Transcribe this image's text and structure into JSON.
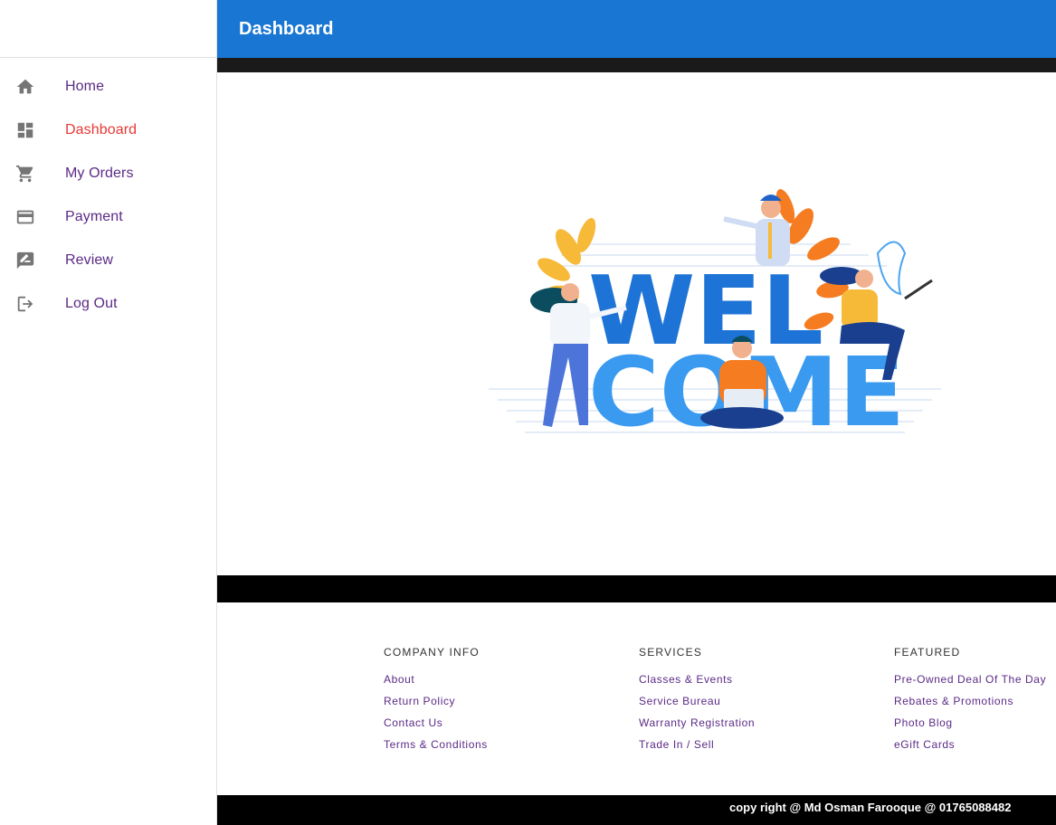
{
  "app": {
    "title": "Dashboard"
  },
  "sidebar": {
    "items": [
      {
        "label": "Home",
        "icon": "home-icon"
      },
      {
        "label": "Dashboard",
        "icon": "dashboard-icon",
        "active": true
      },
      {
        "label": "My Orders",
        "icon": "cart-icon"
      },
      {
        "label": "Payment",
        "icon": "credit-card-icon"
      },
      {
        "label": "Review",
        "icon": "rate-review-icon"
      },
      {
        "label": "Log Out",
        "icon": "logout-icon"
      }
    ]
  },
  "hero": {
    "line1": "WEL",
    "line2": "COME"
  },
  "footer": {
    "columns": [
      {
        "heading": "COMPANY INFO",
        "links": [
          "About",
          "Return Policy",
          "Contact Us",
          "Terms & Conditions"
        ]
      },
      {
        "heading": "SERVICES",
        "links": [
          "Classes & Events",
          "Service Bureau",
          "Warranty Registration",
          "Trade In / Sell"
        ]
      },
      {
        "heading": "FEATURED",
        "links": [
          "Pre-Owned Deal Of The Day",
          "Rebates & Promotions",
          "Photo Blog",
          "eGift Cards"
        ]
      }
    ],
    "copyright": "copy right @ Md Osman Farooque @ 01765088482"
  },
  "colors": {
    "appbar": "#1976d2",
    "active": "#e53935",
    "link": "#5b2a86"
  }
}
